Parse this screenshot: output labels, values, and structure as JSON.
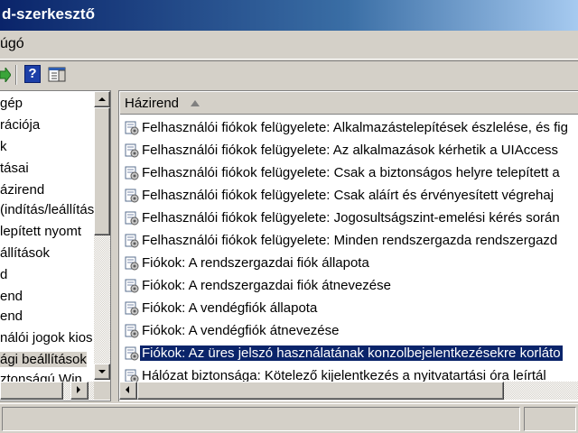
{
  "window": {
    "title": "d-szerkesztő"
  },
  "menubar": {
    "help_label": "úgó"
  },
  "tree": {
    "items": [
      {
        "label": "gép"
      },
      {
        "label": "rációja"
      },
      {
        "label": "k"
      },
      {
        "label": "tásai"
      },
      {
        "label": "ázirend"
      },
      {
        "label": "(indítás/leállítás"
      },
      {
        "label": "lepített nyomt"
      },
      {
        "label": "állítások"
      },
      {
        "label": "d"
      },
      {
        "label": "end"
      },
      {
        "label": "end"
      },
      {
        "label": "nálói jogok kios"
      },
      {
        "label": "ági beállítások"
      },
      {
        "label": "ztonságú Win"
      }
    ]
  },
  "list": {
    "column_header": "Házirend",
    "rows": [
      {
        "label": "Felhasználói fiókok felügyelete: Alkalmazástelepítések észlelése, és fig",
        "icon": "policy-icon"
      },
      {
        "label": "Felhasználói fiókok felügyelete: Az alkalmazások kérhetik a UIAccess",
        "icon": "policy-icon"
      },
      {
        "label": "Felhasználói fiókok felügyelete: Csak a biztonságos helyre telepített a",
        "icon": "policy-icon"
      },
      {
        "label": "Felhasználói fiókok felügyelete: Csak aláírt és érvényesített végrehaj",
        "icon": "policy-icon"
      },
      {
        "label": "Felhasználói fiókok felügyelete: Jogosultságszint-emelési kérés során",
        "icon": "policy-icon"
      },
      {
        "label": "Felhasználói fiókok felügyelete: Minden rendszergazda rendszergazd",
        "icon": "policy-icon"
      },
      {
        "label": "Fiókok: A rendszergazdai fiók állapota",
        "icon": "policy-icon"
      },
      {
        "label": "Fiókok: A rendszergazdai fiók átnevezése",
        "icon": "policy-icon"
      },
      {
        "label": "Fiókok: A vendégfiók állapota",
        "icon": "policy-icon"
      },
      {
        "label": "Fiókok: A vendégfiók átnevezése",
        "icon": "policy-icon"
      },
      {
        "label": "Fiókok: Az üres jelszó használatának konzolbejelentkezésekre korláto",
        "icon": "policy-icon",
        "selected": true
      },
      {
        "label": "Hálózat biztonsága: Kötelező kijelentkezés a nyitvatartási óra leírtál",
        "icon": "policy-icon"
      }
    ]
  },
  "colors": {
    "selection": "#0a246a",
    "face": "#d4d0c8"
  }
}
